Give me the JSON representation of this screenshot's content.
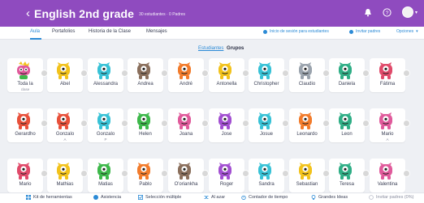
{
  "header": {
    "back_symbol": "‹",
    "title": "English 2nd grade",
    "subtitle": "30 estudiantes · 0 Padres"
  },
  "tabs": [
    "Aula",
    "Portafolios",
    "Historia de la Clase",
    "Mensajes"
  ],
  "tab_actions": {
    "login_students": "Inicio de sesión para estudiantes",
    "invite_parents": "Invitar padres",
    "options": "Opciones"
  },
  "view_toggle": {
    "active": "Estudiantes",
    "other": "Grupos"
  },
  "students": [
    {
      "name": "Toda la",
      "name2": "clase",
      "color": "#e05a9b",
      "kind": "class"
    },
    {
      "name": "Abel",
      "name2": "",
      "color": "#f2c21b"
    },
    {
      "name": "Alessandra",
      "name2": "",
      "color": "#38c2d6"
    },
    {
      "name": "Andrea",
      "name2": "",
      "color": "#8a6f5c"
    },
    {
      "name": "André",
      "name2": "",
      "color": "#f27b2b"
    },
    {
      "name": "Antonella",
      "name2": "",
      "color": "#f2c21b"
    },
    {
      "name": "Christopher",
      "name2": "",
      "color": "#38c2d6"
    },
    {
      "name": "Claudio",
      "name2": "",
      "color": "#9aa3ad"
    },
    {
      "name": "Daniela",
      "name2": "",
      "color": "#2fae86"
    },
    {
      "name": "Fátima",
      "name2": "",
      "color": "#e04a6a"
    },
    {
      "name": "Gerardho",
      "name2": "",
      "color": "#e8503a"
    },
    {
      "name": "Gonzalo",
      "name2": "A",
      "color": "#e8503a"
    },
    {
      "name": "Gonzalo",
      "name2": "P",
      "color": "#38c2d6"
    },
    {
      "name": "Helen",
      "name2": "",
      "color": "#3db84a"
    },
    {
      "name": "Joana",
      "name2": "",
      "color": "#e05a9b"
    },
    {
      "name": "Jose",
      "name2": "",
      "color": "#a24fd1"
    },
    {
      "name": "Josue",
      "name2": "",
      "color": "#38c2d6"
    },
    {
      "name": "Leonardo",
      "name2": "",
      "color": "#f27b2b"
    },
    {
      "name": "Leon",
      "name2": "",
      "color": "#2fae86"
    },
    {
      "name": "Mario",
      "name2": "A",
      "color": "#e05a9b"
    },
    {
      "name": "Mario",
      "name2": "",
      "color": "#e04a6a"
    },
    {
      "name": "Mathias",
      "name2": "",
      "color": "#f2c21b"
    },
    {
      "name": "Matias",
      "name2": "",
      "color": "#3db84a"
    },
    {
      "name": "Pablo",
      "name2": "",
      "color": "#f27b2b"
    },
    {
      "name": "O'oriankha",
      "name2": "",
      "color": "#8a6f5c"
    },
    {
      "name": "Roger",
      "name2": "",
      "color": "#a24fd1"
    },
    {
      "name": "Sandra",
      "name2": "",
      "color": "#38c2d6"
    },
    {
      "name": "Sebastian",
      "name2": "",
      "color": "#f2c21b"
    },
    {
      "name": "Teresa",
      "name2": "",
      "color": "#2fae86"
    },
    {
      "name": "Valentina",
      "name2": "",
      "color": "#e05a9b"
    }
  ],
  "toolbar": {
    "toolkit": "Kit de herramientas",
    "attendance": "Asistencia",
    "multi_select": "Selección múltiple",
    "random": "Al azar",
    "timer": "Contador de tiempo",
    "big_ideas": "Grandes Ideas",
    "invite_parents": "Invitar padres (0%)"
  },
  "colors": {
    "header": "#8f4bbf",
    "accent": "#2b8ad6",
    "background": "#eef0f4"
  }
}
